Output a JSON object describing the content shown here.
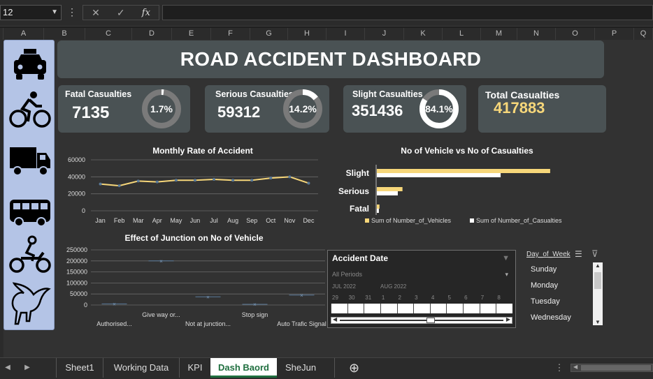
{
  "formula_bar": {
    "name_box": "12",
    "menu_glyph": "⋮",
    "cancel_glyph": "✕",
    "enter_glyph": "✓",
    "fx_label": "fx",
    "formula": ""
  },
  "columns": [
    "A",
    "B",
    "C",
    "D",
    "E",
    "F",
    "G",
    "H",
    "I",
    "J",
    "K",
    "L",
    "M",
    "N",
    "O",
    "P",
    "Q"
  ],
  "dashboard": {
    "title": "ROAD ACCIDENT DASHBOARD",
    "icons": [
      "taxi-icon",
      "bicycle-icon",
      "truck-icon",
      "bus-icon",
      "motorcycle-icon",
      "horse-icon"
    ],
    "kpis": [
      {
        "label": "Fatal Casualties",
        "value": "7135",
        "pct": "1.7%",
        "fraction": 0.017
      },
      {
        "label": "Serious Casualties",
        "value": "59312",
        "pct": "14.2%",
        "fraction": 0.142
      },
      {
        "label": "Slight Casualties",
        "value": "351436",
        "pct": "84.1%",
        "fraction": 0.841
      },
      {
        "label": "Total Casualties",
        "value": "417883"
      }
    ],
    "accent_color": "#f7d77a"
  },
  "chart_data": [
    {
      "type": "line",
      "title": "Monthly Rate of Accident",
      "categories": [
        "Jan",
        "Feb",
        "Mar",
        "Apr",
        "May",
        "Jun",
        "Jul",
        "Aug",
        "Sep",
        "Oct",
        "Nov",
        "Dec"
      ],
      "values": [
        31500,
        29500,
        35000,
        34000,
        36000,
        36000,
        37000,
        36000,
        36000,
        38500,
        40000,
        32500
      ],
      "yticks": [
        "0",
        "20000",
        "40000",
        "60000"
      ],
      "ylim": [
        0,
        60000
      ],
      "grid": true,
      "color": "#f7d77a"
    },
    {
      "type": "bar",
      "title": "No of Vehicle vs No of Casualties",
      "orientation": "horizontal",
      "categories": [
        "Slight",
        "Serious",
        "Fatal"
      ],
      "series": [
        {
          "name": "Sum of Number_of_Vehicles",
          "values": [
            595000,
            88000,
            9000
          ],
          "color": "#f7d77a"
        },
        {
          "name": "Sum of Number_of_Casualties",
          "values": [
            425000,
            72000,
            7000
          ],
          "color": "#ffffff"
        }
      ],
      "legend": "bottom"
    },
    {
      "type": "scatter",
      "title": "Effect of Junction on No of Vehicle",
      "categories": [
        "Authorised...",
        "Give way or...",
        "Not at junction...",
        "Stop sign",
        "Auto Trafic Signal"
      ],
      "values": [
        5000,
        200000,
        37000,
        3000,
        45000
      ],
      "yticks": [
        "0",
        "50000",
        "100000",
        "150000",
        "200000",
        "250000"
      ],
      "ylim": [
        0,
        250000
      ],
      "grid": true
    }
  ],
  "slicer": {
    "title": "Accident Date",
    "period_label": "All Periods",
    "months": [
      "JUL 2022",
      "AUG 2022"
    ],
    "days": [
      "29",
      "30",
      "31",
      "1",
      "2",
      "3",
      "4",
      "5",
      "6",
      "7",
      "8"
    ]
  },
  "day_slicer": {
    "title": "Day_of_Week",
    "items": [
      "Sunday",
      "Monday",
      "Tuesday",
      "Wednesday"
    ]
  },
  "tabs": [
    "Sheet1",
    "Working Data",
    "KPI",
    "Dash Baord",
    "SheJun"
  ],
  "active_tab": "Dash Baord",
  "add_sheet_glyph": "⊕",
  "status_menu_glyph": "⋮"
}
